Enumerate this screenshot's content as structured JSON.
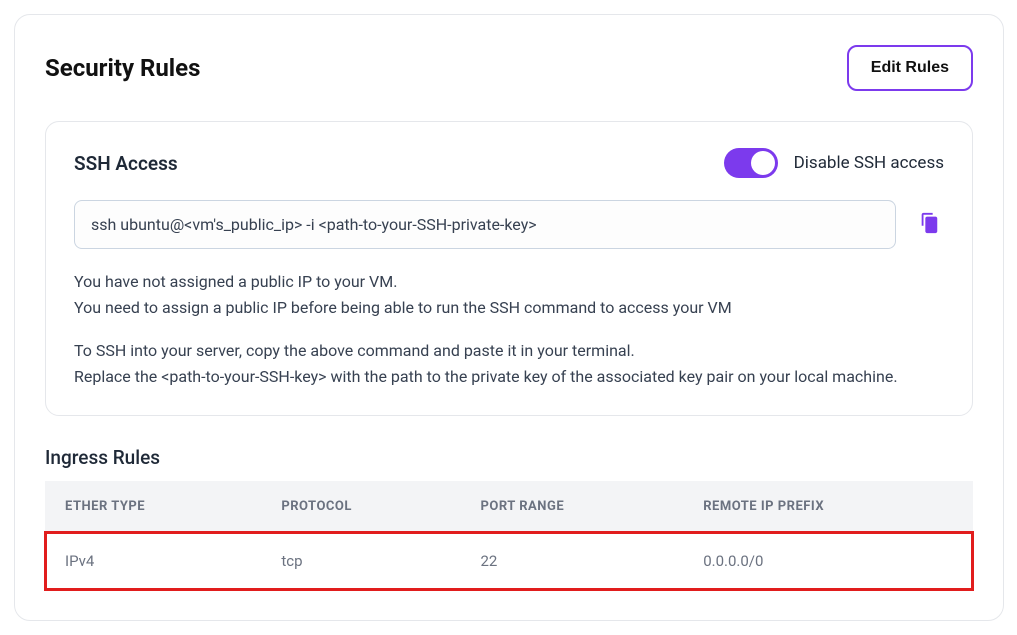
{
  "header": {
    "title": "Security Rules",
    "edit_button": "Edit Rules"
  },
  "ssh": {
    "title": "SSH Access",
    "toggle_label": "Disable SSH access",
    "command": "ssh ubuntu@<vm's_public_ip> -i <path-to-your-SSH-private-key>",
    "warn_line1": "You have not assigned a public IP to your VM.",
    "warn_line2": "You need to assign a public IP before being able to run the SSH command to access your VM",
    "help_line1": "To SSH into your server, copy the above command and paste it in your terminal.",
    "help_line2": "Replace the <path-to-your-SSH-key> with the path to the private key of the associated key pair on your local machine."
  },
  "ingress": {
    "title": "Ingress Rules",
    "columns": {
      "ether": "ETHER TYPE",
      "protocol": "PROTOCOL",
      "port": "PORT RANGE",
      "remote": "REMOTE IP PREFIX"
    },
    "rows": [
      {
        "ether": "IPv4",
        "protocol": "tcp",
        "port": "22",
        "remote": "0.0.0.0/0"
      }
    ]
  }
}
